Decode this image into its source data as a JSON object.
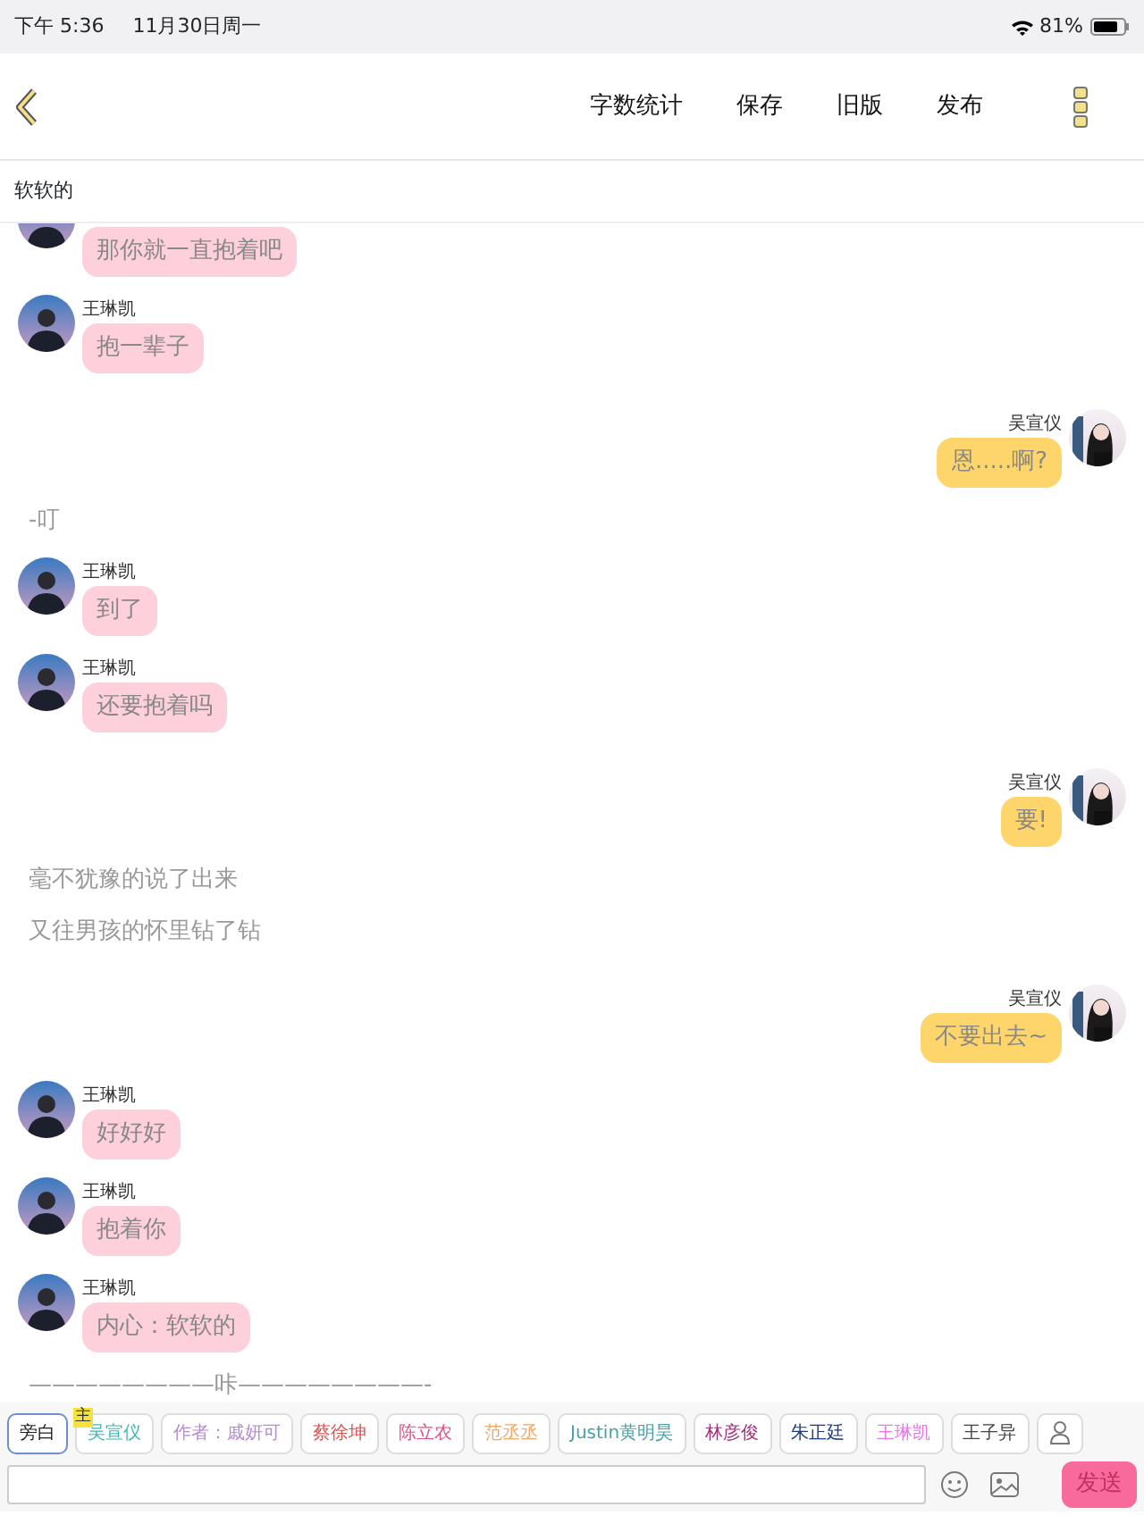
{
  "status_bar": {
    "time": "下午 5:36",
    "date": "11月30日周一",
    "battery": "81%"
  },
  "header": {
    "actions": [
      "字数统计",
      "保存",
      "旧版",
      "发布"
    ]
  },
  "title": "软软的",
  "messages": [
    {
      "kind": "left",
      "text": "那你就一直抱着吧",
      "cut": true
    },
    {
      "kind": "left",
      "name": "王琳凯",
      "text": "抱一辈子"
    },
    {
      "kind": "right",
      "name": "吴宣仪",
      "text": "恩.....啊?"
    },
    {
      "kind": "narration",
      "text": "-叮"
    },
    {
      "kind": "left",
      "name": "王琳凯",
      "text": "到了"
    },
    {
      "kind": "left",
      "name": "王琳凯",
      "text": "还要抱着吗"
    },
    {
      "kind": "right",
      "name": "吴宣仪",
      "text": "要!"
    },
    {
      "kind": "narration",
      "text": "毫不犹豫的说了出来"
    },
    {
      "kind": "narration",
      "text": "又往男孩的怀里钻了钻"
    },
    {
      "kind": "right",
      "name": "吴宣仪",
      "text": "不要出去~"
    },
    {
      "kind": "left",
      "name": "王琳凯",
      "text": "好好好"
    },
    {
      "kind": "left",
      "name": "王琳凯",
      "text": "抱着你"
    },
    {
      "kind": "left",
      "name": "王琳凯",
      "text": "内心：软软的"
    },
    {
      "kind": "divider",
      "text": "————————咔————————-"
    }
  ],
  "roles": [
    {
      "label": "旁白",
      "color": "#222222",
      "selected": true
    },
    {
      "label": "吴宣仪",
      "color": "#3fb8b0",
      "selected": false,
      "badge": "主"
    },
    {
      "label": "作者：戚妍可",
      "color": "#b58ad6",
      "selected": false
    },
    {
      "label": "蔡徐坤",
      "color": "#d9534f",
      "selected": false
    },
    {
      "label": "陈立农",
      "color": "#e0508a",
      "selected": false
    },
    {
      "label": "范丞丞",
      "color": "#f0a868",
      "selected": false
    },
    {
      "label": "Justin黄明昊",
      "color": "#4aa0a8",
      "selected": false
    },
    {
      "label": "林彦俊",
      "color": "#a0307a",
      "selected": false
    },
    {
      "label": "朱正廷",
      "color": "#1a3a7a",
      "selected": false
    },
    {
      "label": "王琳凯",
      "color": "#e878e8",
      "selected": false
    },
    {
      "label": "王子异",
      "color": "#444444",
      "selected": false
    }
  ],
  "composer": {
    "send": "发送"
  }
}
